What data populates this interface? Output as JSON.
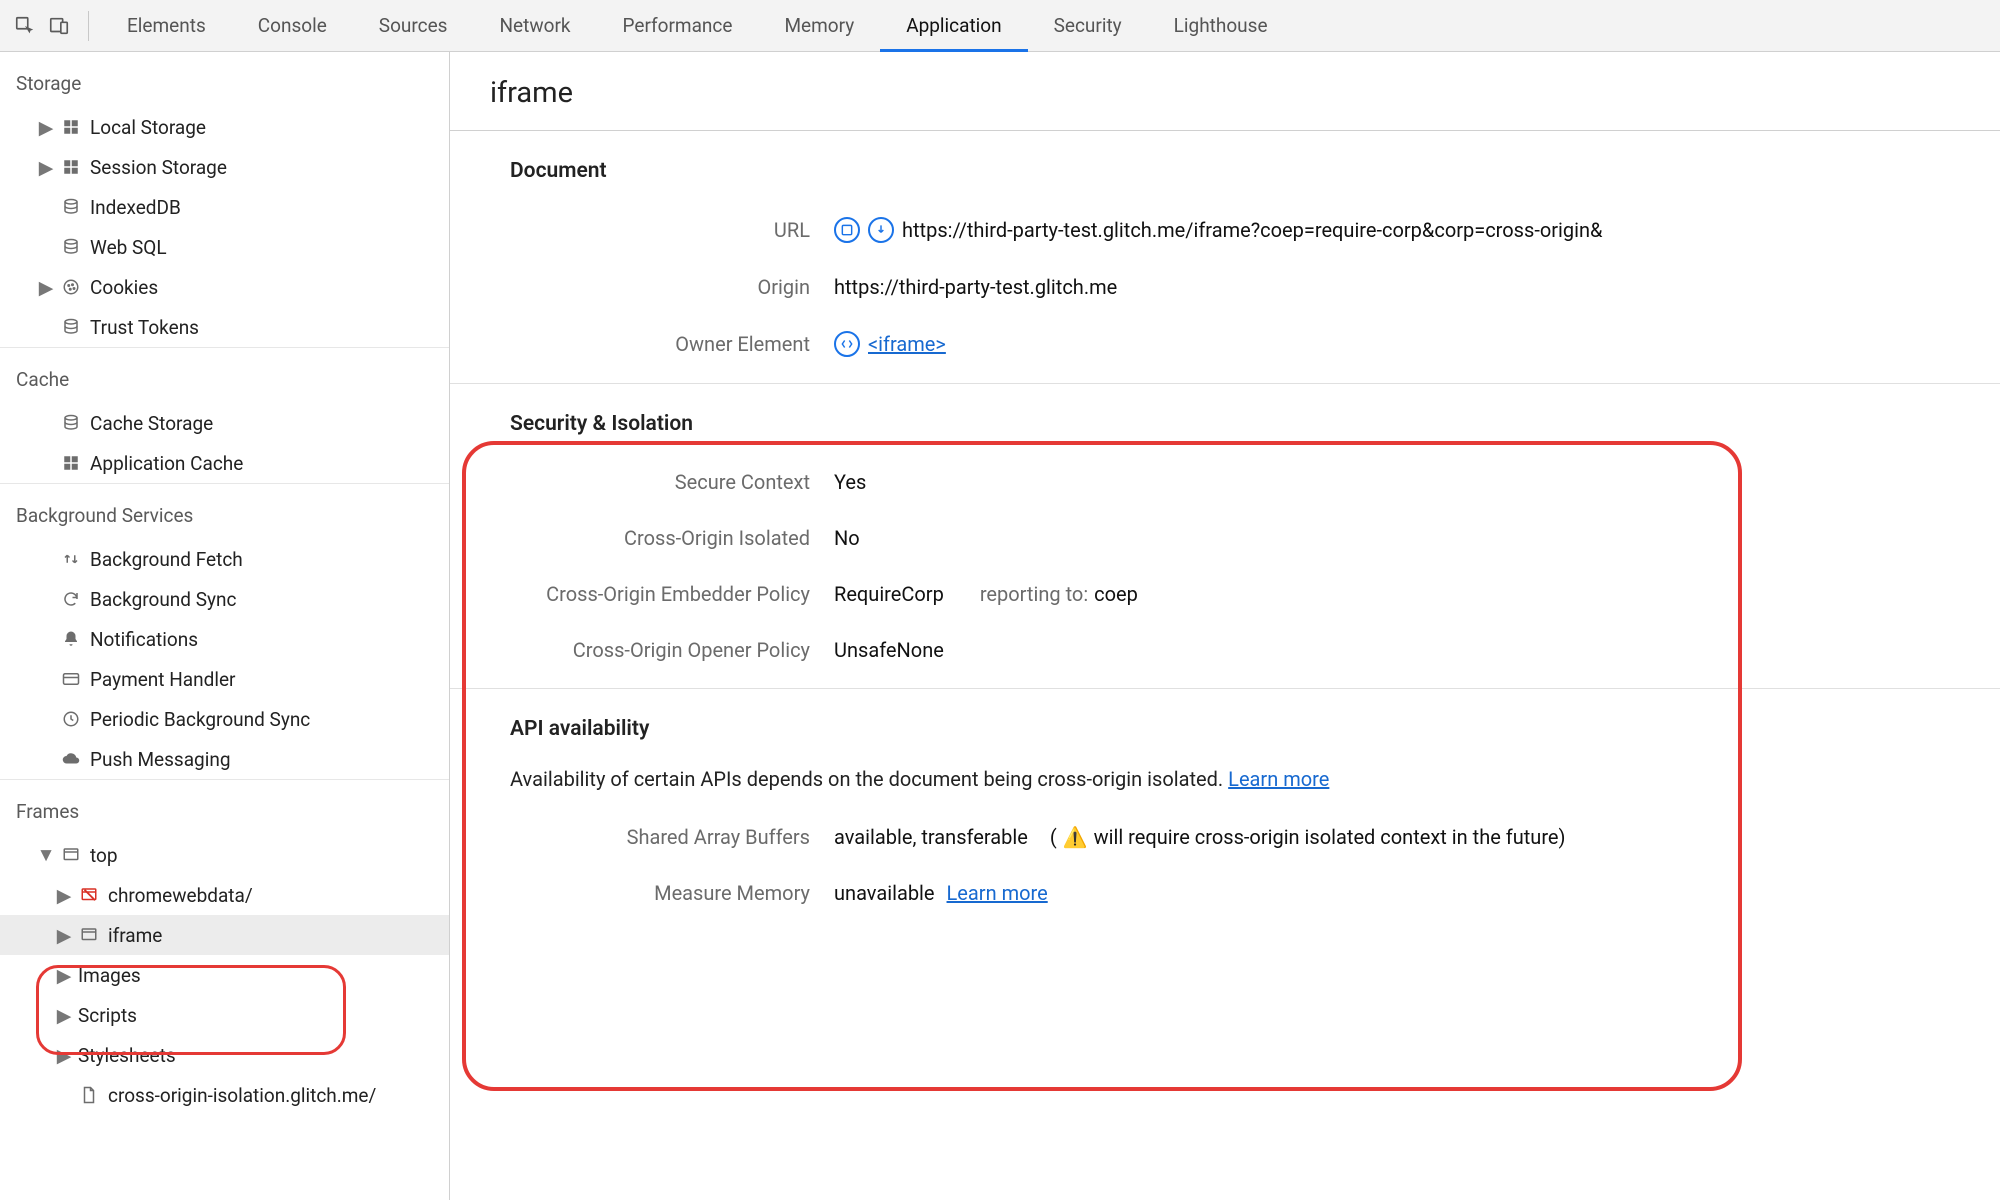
{
  "toolbar": {
    "tabs": [
      "Elements",
      "Console",
      "Sources",
      "Network",
      "Performance",
      "Memory",
      "Application",
      "Security",
      "Lighthouse"
    ],
    "active_index": 6
  },
  "sidebar": {
    "sections": {
      "storage": {
        "title": "Storage",
        "items": [
          "Local Storage",
          "Session Storage",
          "IndexedDB",
          "Web SQL",
          "Cookies",
          "Trust Tokens"
        ]
      },
      "cache": {
        "title": "Cache",
        "items": [
          "Cache Storage",
          "Application Cache"
        ]
      },
      "background": {
        "title": "Background Services",
        "items": [
          "Background Fetch",
          "Background Sync",
          "Notifications",
          "Payment Handler",
          "Periodic Background Sync",
          "Push Messaging"
        ]
      },
      "frames": {
        "title": "Frames",
        "top_label": "top",
        "children_lvl1": [
          "chromewebdata/",
          "iframe"
        ],
        "children_lvl2": [
          "Images",
          "Scripts",
          "Stylesheets"
        ],
        "file": "cross-origin-isolation.glitch.me/"
      }
    }
  },
  "main": {
    "title": "iframe",
    "document": {
      "heading": "Document",
      "url_label": "URL",
      "url_value": "https://third-party-test.glitch.me/iframe?coep=require-corp&corp=cross-origin&",
      "origin_label": "Origin",
      "origin_value": "https://third-party-test.glitch.me",
      "owner_label": "Owner Element",
      "owner_value": "<iframe>"
    },
    "security": {
      "heading": "Security & Isolation",
      "secure_label": "Secure Context",
      "secure_value": "Yes",
      "coi_label": "Cross-Origin Isolated",
      "coi_value": "No",
      "coep_label": "Cross-Origin Embedder Policy",
      "coep_value": "RequireCorp",
      "coep_reporting_label": "reporting to:",
      "coep_reporting_value": "coep",
      "coop_label": "Cross-Origin Opener Policy",
      "coop_value": "UnsafeNone"
    },
    "api": {
      "heading": "API availability",
      "desc": "Availability of certain APIs depends on the document being cross-origin isolated.",
      "learn_more": "Learn more",
      "sab_label": "Shared Array Buffers",
      "sab_value": "available, transferable",
      "sab_warn_prefix": "(",
      "sab_warning": "will require cross-origin isolated context in the future)",
      "mm_label": "Measure Memory",
      "mm_value": "unavailable"
    }
  }
}
